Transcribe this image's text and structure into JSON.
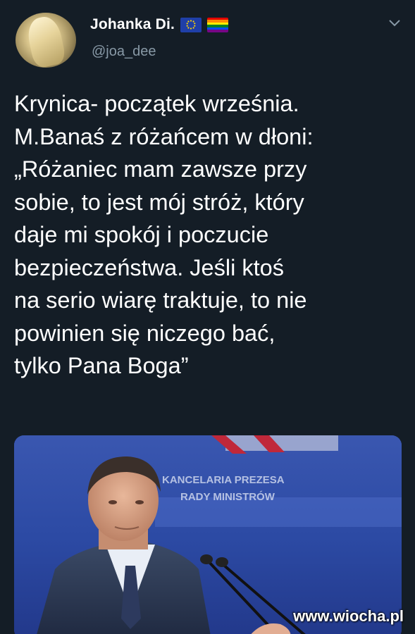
{
  "author": {
    "display_name": "Johanka Di.",
    "handle": "@joa_dee",
    "badges": [
      "eu-flag-icon",
      "rainbow-flag-icon"
    ]
  },
  "tweet": {
    "lines": [
      "Krynica- początek września.",
      "M.Banaś z różańcem w dłoni:",
      " „Różaniec mam zawsze przy",
      "sobie, to jest mój stróż, który",
      "daje mi spokój i poczucie",
      "bezpieczeństwa. Jeśli ktoś",
      "na serio wiarę traktuje, to nie",
      "powinien się niczego bać,",
      "tylko Pana Boga”"
    ]
  },
  "media": {
    "backdrop_text_line1": "KANCELARIA PREZESA",
    "backdrop_text_line2": "RADY MINISTRÓW"
  },
  "watermark": "www.wiocha.pl",
  "colors": {
    "background": "#141d26",
    "secondary_text": "#8899a6",
    "eu_blue": "#1f3fa8",
    "eu_star": "#ffd400"
  }
}
